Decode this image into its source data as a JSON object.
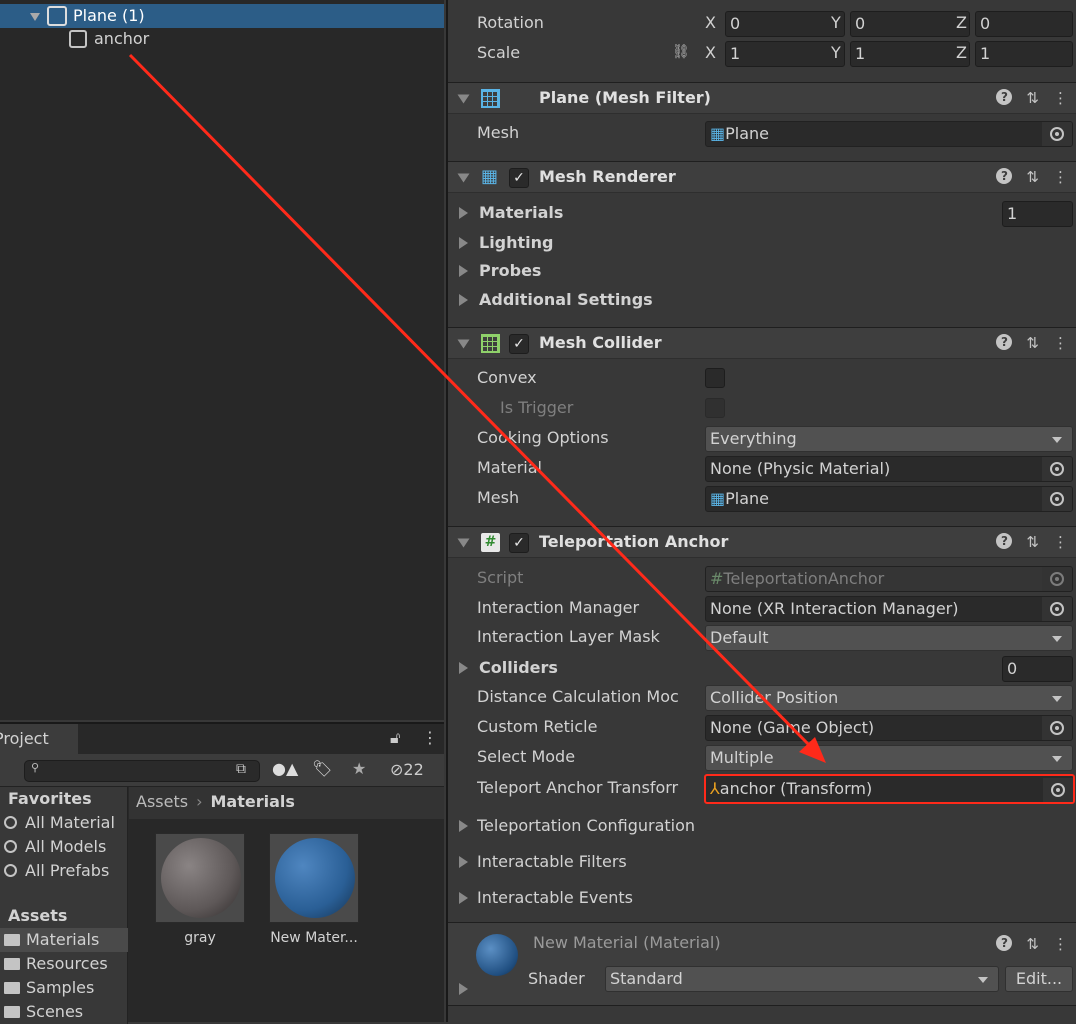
{
  "hierarchy": {
    "items": [
      {
        "label": "Plane (1)",
        "selected": true
      },
      {
        "label": "anchor"
      }
    ]
  },
  "inspector": {
    "transform": {
      "rotation": {
        "label": "Rotation",
        "x": "0",
        "y": "0",
        "z": "0"
      },
      "scale": {
        "label": "Scale",
        "x": "1",
        "y": "1",
        "z": "1"
      },
      "axes": [
        "X",
        "Y",
        "Z"
      ]
    },
    "mesh_filter": {
      "title": "Plane (Mesh Filter)",
      "mesh_label": "Mesh",
      "mesh_value": "Plane"
    },
    "mesh_renderer": {
      "title": "Mesh Renderer",
      "enabled": true,
      "materials": "Materials",
      "materials_count": "1",
      "lighting": "Lighting",
      "probes": "Probes",
      "additional": "Additional Settings"
    },
    "mesh_collider": {
      "title": "Mesh Collider",
      "enabled": true,
      "convex": "Convex",
      "is_trigger": "Is Trigger",
      "cooking_label": "Cooking Options",
      "cooking_value": "Everything",
      "material_label": "Material",
      "material_value": "None (Physic Material)",
      "mesh_label": "Mesh",
      "mesh_value": "Plane"
    },
    "teleport": {
      "title": "Teleportation Anchor",
      "enabled": true,
      "script_label": "Script",
      "script_value": "TeleportationAnchor",
      "im_label": "Interaction Manager",
      "im_value": "None (XR Interaction Manager)",
      "ilm_label": "Interaction Layer Mask",
      "ilm_value": "Default",
      "colliders_label": "Colliders",
      "colliders_count": "0",
      "dcm_label": "Distance Calculation Moc",
      "dcm_value": "Collider Position",
      "cr_label": "Custom Reticle",
      "cr_value": "None (Game Object)",
      "sm_label": "Select Mode",
      "sm_value": "Multiple",
      "tat_label": "Teleport Anchor Transforr",
      "tat_value": "anchor (Transform)",
      "config": "Teleportation Configuration",
      "filters": "Interactable Filters",
      "events": "Interactable Events"
    },
    "material": {
      "title": "New Material (Material)",
      "shader_label": "Shader",
      "shader_value": "Standard",
      "edit_label": "Edit..."
    }
  },
  "project": {
    "tab": "Project",
    "hidden_count": "22",
    "search_placeholder": "",
    "favorites": {
      "title": "Favorites",
      "items": [
        "All Material",
        "All Models",
        "All Prefabs"
      ]
    },
    "assets": {
      "title": "Assets",
      "items": [
        "Materials",
        "Resources",
        "Samples",
        "Scenes"
      ]
    },
    "breadcrumb": {
      "root": "Assets",
      "current": "Materials"
    },
    "files": [
      {
        "name": "gray",
        "color": "#6e6868"
      },
      {
        "name": "New Mater...",
        "color": "#2f6aa3"
      }
    ]
  },
  "annotation": {
    "color": "#ff2a1a"
  }
}
